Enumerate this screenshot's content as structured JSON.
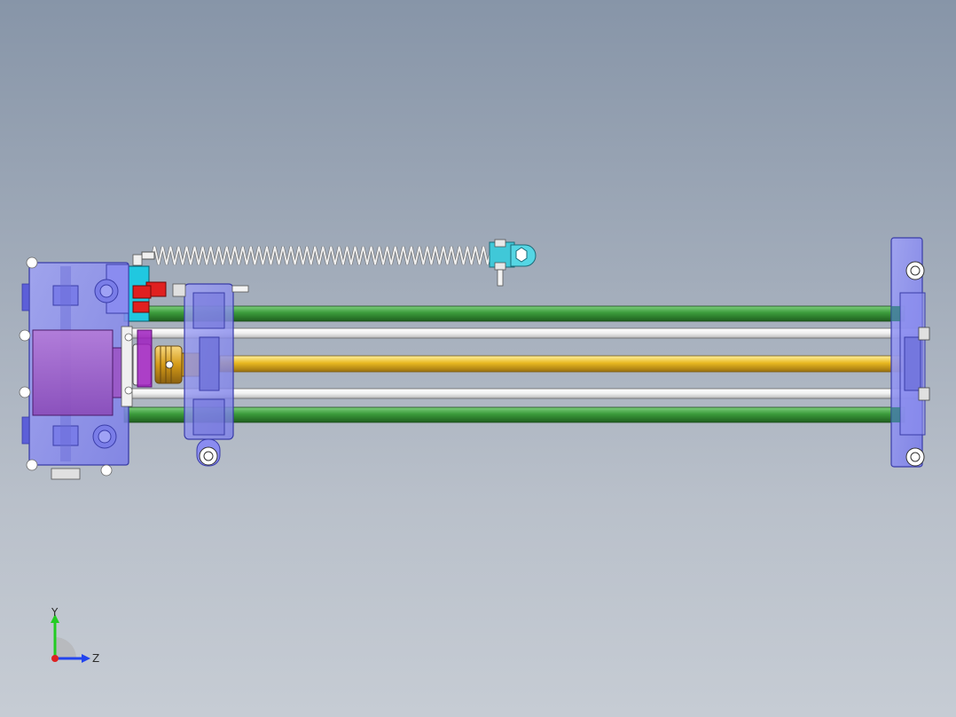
{
  "viewport": {
    "background_top": "#8795a8",
    "background_bottom": "#c6ccd4"
  },
  "triad": {
    "y_label": "Y",
    "z_label": "Z",
    "y_color": "#22cc22",
    "z_color": "#2244ee",
    "x_color": "#dd2222"
  },
  "model": {
    "colors": {
      "housing": "#8a8cf0",
      "housing_dark": "#5c5fd8",
      "motor": "#9a5ac8",
      "guide_rod": "#3a9a3a",
      "lead_screw": "#e8b820",
      "polished_rod": "#f4f4f4",
      "spring": "#f0f0f0",
      "clevis": "#40c8d8",
      "switch_red": "#e02020",
      "switch_cyan": "#20c8e0",
      "coupling": "#e0a020",
      "hub_purple": "#a020c0"
    },
    "components": [
      "motor-housing-block",
      "end-support-plate",
      "carriage-block",
      "upper-guide-rod",
      "lower-guide-rod",
      "upper-polished-rod",
      "lower-polished-rod",
      "lead-screw",
      "extension-spring",
      "spring-clevis",
      "limit-switch",
      "shaft-coupling"
    ]
  }
}
